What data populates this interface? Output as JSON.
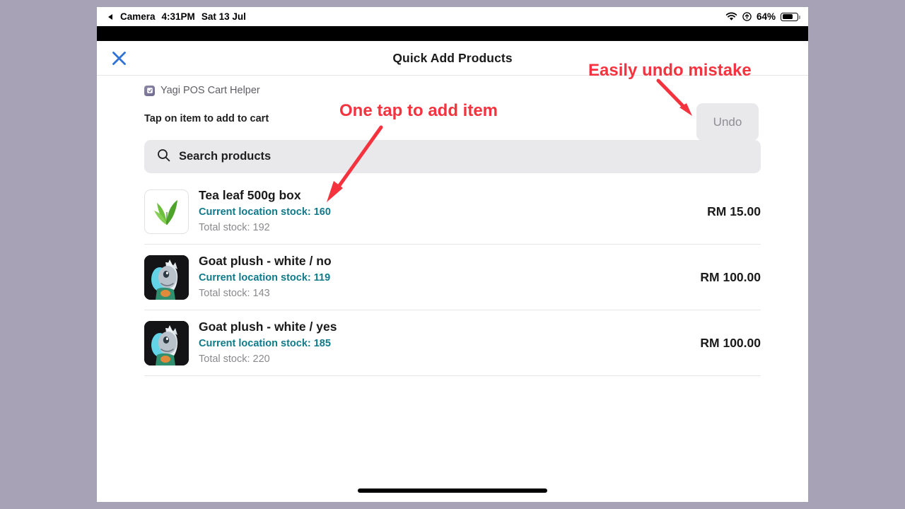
{
  "status_bar": {
    "back_app": "Camera",
    "time": "4:31PM",
    "date": "Sat 13 Jul",
    "battery_percent": "64%",
    "icons": [
      "back-triangle-icon",
      "wifi-icon",
      "location-icon",
      "battery-icon"
    ]
  },
  "header": {
    "title": "Quick Add Products",
    "close_icon": "close-icon"
  },
  "app_info": {
    "label": "Yagi POS Cart Helper",
    "icon": "app-icon"
  },
  "hint": {
    "text": "Tap on item to add to cart"
  },
  "undo": {
    "label": "Undo",
    "enabled": false
  },
  "search": {
    "placeholder": "Search products",
    "value": "Search products",
    "icon": "search-icon"
  },
  "products": [
    {
      "name": "Tea leaf 500g box",
      "current_stock_label": "Current location stock: 160",
      "total_stock_label": "Total stock: 192",
      "price": "RM 15.00",
      "thumb": "tea-leaf-icon"
    },
    {
      "name": "Goat plush - white / no",
      "current_stock_label": "Current location stock: 119",
      "total_stock_label": "Total stock: 143",
      "price": "RM 100.00",
      "thumb": "goat-plush-icon"
    },
    {
      "name": "Goat plush - white / yes",
      "current_stock_label": "Current location stock: 185",
      "total_stock_label": "Total stock: 220",
      "price": "RM 100.00",
      "thumb": "goat-plush-icon"
    }
  ],
  "annotations": [
    {
      "id": "undo",
      "text": "Easily undo mistake"
    },
    {
      "id": "tap",
      "text": "One tap to add item"
    }
  ],
  "colors": {
    "accent_blue": "#2f72d6",
    "stock_teal": "#0f7a8a",
    "annotation_red": "#f5333f",
    "backdrop": "#a7a2b6"
  }
}
